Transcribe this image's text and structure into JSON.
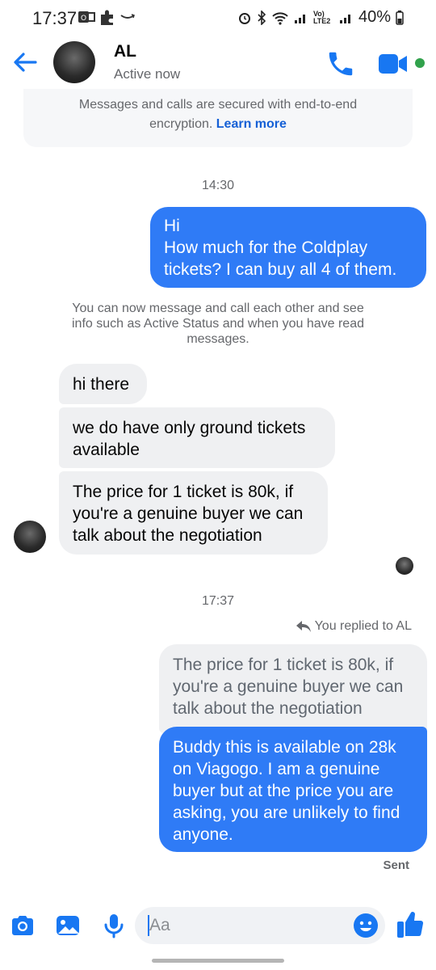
{
  "status_bar": {
    "time": "17:37",
    "battery": "40%",
    "network": "Vo) LTE2"
  },
  "header": {
    "contact_name": "AL",
    "contact_status": "Active now"
  },
  "encryption_notice": {
    "text_line1": "Messages and calls are secured with end-to-end",
    "text_line2": "encryption.",
    "link": "Learn more"
  },
  "conversation": {
    "timestamp1": "14:30",
    "outgoing1": [
      "Hi",
      "How much for the Coldplay",
      "tickets? I can buy all 4 of them."
    ],
    "system_message": [
      "You can now message and call each other and see",
      "info such as Active Status and when you have read",
      "messages."
    ],
    "incoming": [
      {
        "lines": [
          "hi there"
        ]
      },
      {
        "lines": [
          "we do have only ground tickets",
          "available"
        ]
      },
      {
        "lines": [
          "The price for 1 ticket is 80k, if",
          "you're a genuine buyer we can",
          "talk about the negotiation"
        ]
      }
    ],
    "timestamp2": "17:37",
    "reply_note": "You replied to AL",
    "quoted": [
      "The price for 1 ticket is 80k, if",
      "you're a genuine buyer we can",
      "talk about the negotiation"
    ],
    "outgoing2": [
      "Buddy this is available on 28k",
      "on Viagogo. I am a genuine",
      "buyer but at the price you are",
      "asking, you are unlikely to find",
      "anyone."
    ],
    "sent_label": "Sent"
  },
  "composer": {
    "placeholder": "Aa"
  },
  "colors": {
    "accent": "#1877f2",
    "outgoing_bubble": "#2f7bf6",
    "incoming_bubble": "#eff0f2",
    "active_dot": "#31a24c"
  }
}
